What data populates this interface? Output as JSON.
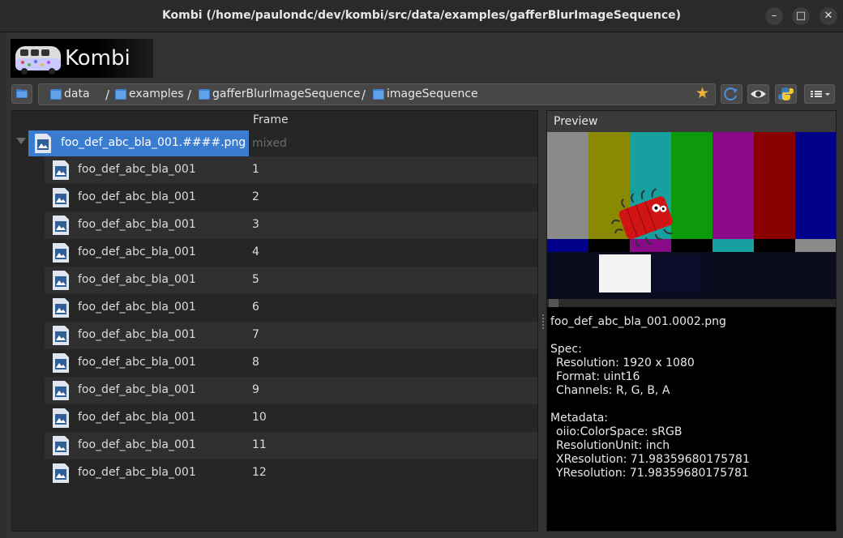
{
  "window": {
    "title": "Kombi (/home/paulondc/dev/kombi/src/data/examples/gafferBlurImageSequence)",
    "minimize_glyph": "–",
    "maximize_glyph": "□",
    "close_glyph": "✕"
  },
  "app": {
    "brand": "Kombi"
  },
  "path": {
    "crumbs": [
      "data",
      "examples",
      "gafferBlurImageSequence",
      "imageSequence"
    ],
    "separator": "/",
    "star_glyph": "★"
  },
  "tree": {
    "frame_header": "Frame",
    "root": {
      "name": "foo_def_abc_bla_001.####.png",
      "frame": "mixed"
    },
    "rows": [
      {
        "name": "foo_def_abc_bla_001",
        "frame": "1"
      },
      {
        "name": "foo_def_abc_bla_001",
        "frame": "2"
      },
      {
        "name": "foo_def_abc_bla_001",
        "frame": "3"
      },
      {
        "name": "foo_def_abc_bla_001",
        "frame": "4"
      },
      {
        "name": "foo_def_abc_bla_001",
        "frame": "5"
      },
      {
        "name": "foo_def_abc_bla_001",
        "frame": "6"
      },
      {
        "name": "foo_def_abc_bla_001",
        "frame": "7"
      },
      {
        "name": "foo_def_abc_bla_001",
        "frame": "8"
      },
      {
        "name": "foo_def_abc_bla_001",
        "frame": "9"
      },
      {
        "name": "foo_def_abc_bla_001",
        "frame": "10"
      },
      {
        "name": "foo_def_abc_bla_001",
        "frame": "11"
      },
      {
        "name": "foo_def_abc_bla_001",
        "frame": "12"
      }
    ]
  },
  "preview": {
    "title": "Preview",
    "filename": "foo_def_abc_bla_001.0002.png",
    "spec_label": "Spec:",
    "resolution": "Resolution: 1920 x 1080",
    "format": "Format: uint16",
    "channels": "Channels: R, G, B, A",
    "metadata_label": "Metadata:",
    "colorspace": "oiio:ColorSpace: sRGB",
    "resolution_unit": "ResolutionUnit: inch",
    "xres": "XResolution: 71.98359680175781",
    "yres": "YResolution: 71.98359680175781"
  },
  "colors": {
    "selection": "#3a7dd0",
    "star": "#f3b234",
    "panel": "#262626"
  }
}
